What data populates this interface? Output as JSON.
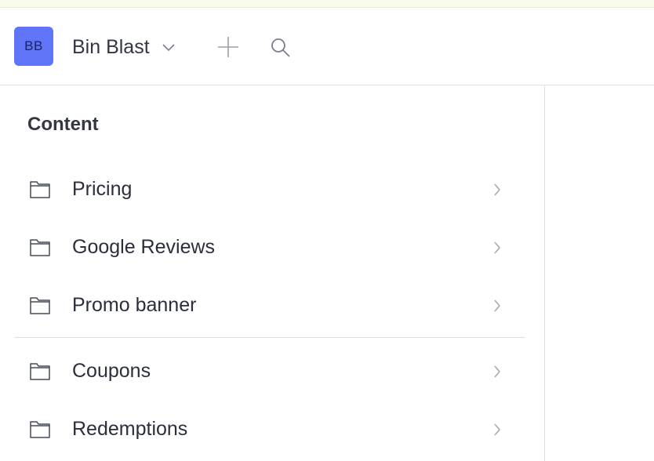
{
  "header": {
    "avatar_initials": "BB",
    "avatar_color": "#5f74f7",
    "project_name": "Bin Blast"
  },
  "icons": {
    "dropdown": "chevron-down-icon",
    "add": "plus-icon",
    "search": "search-icon",
    "item": "folder-icon",
    "item_arrow": "chevron-right-icon"
  },
  "sidebar": {
    "section_title": "Content",
    "groups": [
      {
        "items": [
          {
            "label": "Pricing"
          },
          {
            "label": "Google Reviews"
          },
          {
            "label": "Promo banner"
          }
        ]
      },
      {
        "items": [
          {
            "label": "Coupons"
          },
          {
            "label": "Redemptions"
          }
        ]
      }
    ]
  }
}
